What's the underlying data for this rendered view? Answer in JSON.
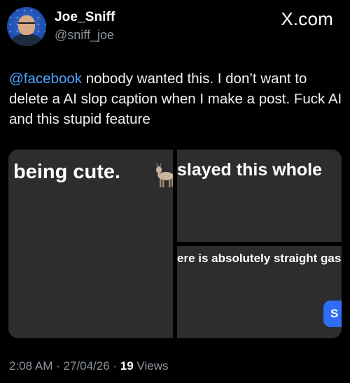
{
  "author": {
    "display_name": "Joe_Sniff",
    "handle": "@sniff_joe"
  },
  "brand": "X.com",
  "post": {
    "mention": "@facebook",
    "text": " nobody wanted this. I don’t want to delete a AI slop caption when I make a post. Fuck AI and this stupid feature"
  },
  "media": {
    "left_caption": "being cute.",
    "left_emoji_icon": "goat-icon",
    "top_right_caption": "slayed this whole",
    "bottom_right_caption": "ere is absolutely straight gas",
    "send_button_label": "S"
  },
  "meta": {
    "time": "2:08 AM",
    "sep1": " · ",
    "date": "27/04/26",
    "sep2": " · ",
    "views_count": "19",
    "views_label": " Views"
  },
  "colors": {
    "background": "#000000",
    "mention": "#4da3ff",
    "muted": "#8b949c",
    "panel": "#2d2d2e",
    "button": "#2f6df6"
  }
}
